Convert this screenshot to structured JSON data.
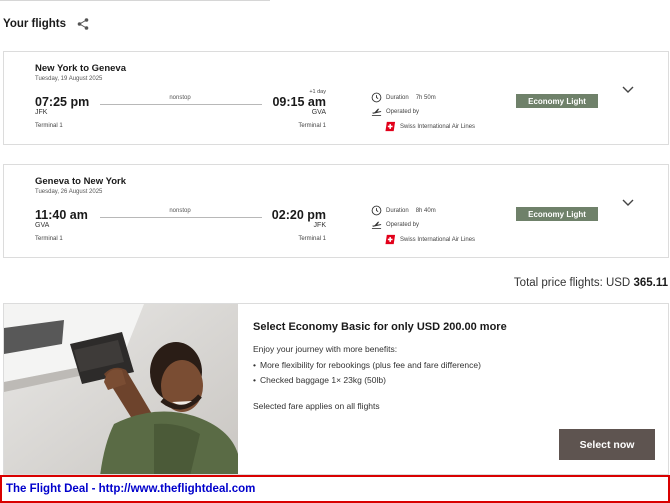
{
  "header": {
    "title": "Your flights",
    "share_icon": "share-icon"
  },
  "flights": [
    {
      "route": "New York to Geneva",
      "date": "Tuesday, 19 August 2025",
      "departure": {
        "time": "07:25 pm",
        "code": "JFK",
        "terminal": "Terminal 1"
      },
      "arrival": {
        "time": "09:15 am",
        "code": "GVA",
        "terminal": "Terminal 1",
        "day_offset": "+1 day"
      },
      "stops": "nonstop",
      "duration_label": "Duration",
      "duration": "7h 50m",
      "operated_by": "Operated by",
      "airline": "Swiss International Air Lines",
      "fare": "Economy Light"
    },
    {
      "route": "Geneva to New York",
      "date": "Tuesday, 26 August 2025",
      "departure": {
        "time": "11:40 am",
        "code": "GVA",
        "terminal": "Terminal 1"
      },
      "arrival": {
        "time": "02:20 pm",
        "code": "JFK",
        "terminal": "Terminal 1"
      },
      "stops": "nonstop",
      "duration_label": "Duration",
      "duration": "8h 40m",
      "operated_by": "Operated by",
      "airline": "Swiss International Air Lines",
      "fare": "Economy Light"
    }
  ],
  "total": {
    "label": "Total price flights: USD",
    "amount": "365.11"
  },
  "upsell": {
    "title": "Select Economy Basic for only USD 200.00 more",
    "intro": "Enjoy your journey with more benefits:",
    "benefits": [
      "More flexibility for rebookings (plus fee and fare difference)",
      "Checked baggage 1× 23kg (50lb)"
    ],
    "note": "Selected fare applies on all flights",
    "button": "Select now"
  },
  "footer": {
    "text": "The Flight Deal - http://www.theflightdeal.com"
  },
  "colors": {
    "fare_badge": "#6f816a",
    "select_button": "#5e5450",
    "footer_border": "#d90000",
    "footer_link": "#0000cc",
    "swiss_red": "#e2001a"
  }
}
